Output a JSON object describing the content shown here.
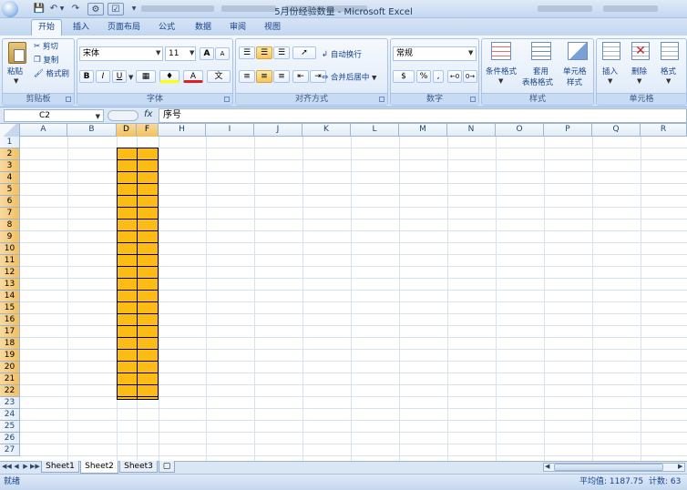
{
  "window": {
    "title": "5月份经验数量 - Microsoft Excel"
  },
  "tabs": [
    {
      "label": "开始"
    },
    {
      "label": "插入"
    },
    {
      "label": "页面布局"
    },
    {
      "label": "公式"
    },
    {
      "label": "数据"
    },
    {
      "label": "审阅"
    },
    {
      "label": "视图"
    }
  ],
  "ribbon": {
    "clipboard": {
      "label": "剪贴板",
      "paste": "粘贴",
      "cut": "剪切",
      "copy": "复制",
      "format_painter": "格式刷"
    },
    "font": {
      "label": "字体",
      "font_name": "宋体",
      "font_size": "11",
      "bold": "B",
      "italic": "I",
      "underline": "U",
      "grow": "A",
      "shrink": "A",
      "color_a": "A",
      "wen": "文"
    },
    "alignment": {
      "label": "对齐方式",
      "wrap": "自动换行",
      "merge": "合并后居中"
    },
    "number": {
      "label": "数字",
      "format": "常规",
      "percent": "%",
      "comma": ","
    },
    "styles": {
      "label": "样式",
      "conditional": "条件格式",
      "table_format_1": "套用",
      "table_format_2": "表格格式",
      "cell_style_1": "单元格",
      "cell_style_2": "样式"
    },
    "cells": {
      "label": "单元格",
      "insert": "插入",
      "delete": "删除",
      "format": "格式"
    }
  },
  "formula_bar": {
    "name_box": "C2",
    "fx": "fx",
    "content": "序号"
  },
  "columns": [
    "A",
    "B",
    "D",
    "F",
    "H",
    "I",
    "J",
    "K",
    "L",
    "M",
    "N",
    "O",
    "P",
    "Q",
    "R"
  ],
  "rows": [
    "1",
    "2",
    "3",
    "4",
    "5",
    "6",
    "7",
    "8",
    "9",
    "10",
    "11",
    "12",
    "13",
    "14",
    "15",
    "16",
    "17",
    "18",
    "19",
    "20",
    "21",
    "22",
    "23",
    "24",
    "25",
    "26",
    "27"
  ],
  "sheets": [
    "Sheet1",
    "Sheet2",
    "Sheet3"
  ],
  "active_sheet": "Sheet2",
  "status": {
    "ready": "就绪",
    "average": "平均值: 1187.75",
    "count": "计数: 63"
  },
  "colors": {
    "highlight_fill": "#fdbb16",
    "ribbon_blue": "#c2d7f0",
    "header_active": "#f1c15f"
  }
}
